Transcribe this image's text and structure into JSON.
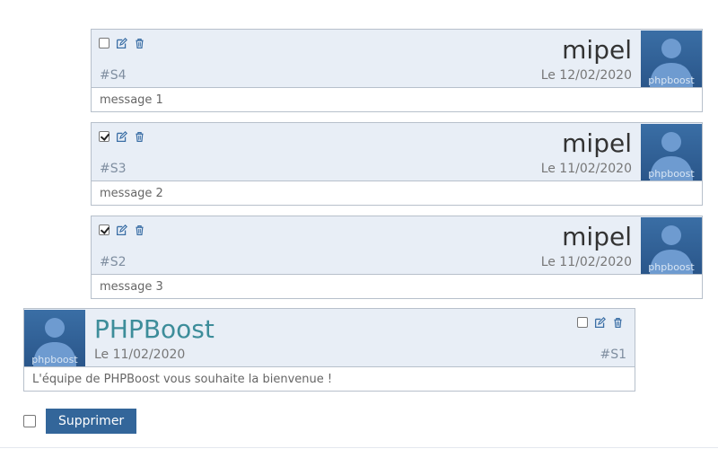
{
  "messages": [
    {
      "checked": false,
      "author": "mipel",
      "id": "#S4",
      "date": "Le 12/02/2020",
      "body": "message 1",
      "avatar_label": "phpboost"
    },
    {
      "checked": true,
      "author": "mipel",
      "id": "#S3",
      "date": "Le 11/02/2020",
      "body": "message 2",
      "avatar_label": "phpboost"
    },
    {
      "checked": true,
      "author": "mipel",
      "id": "#S2",
      "date": "Le 11/02/2020",
      "body": "message 3",
      "avatar_label": "phpboost"
    },
    {
      "checked": false,
      "author": "PHPBoost",
      "id": "#S1",
      "date": "Le 11/02/2020",
      "body": "L'équipe de PHPBoost vous souhaite la bienvenue !",
      "avatar_label": "phpboost"
    }
  ],
  "footer": {
    "delete_label": "Supprimer",
    "select_all_checked": false
  },
  "colors": {
    "header_bg": "#e8eef6",
    "accent": "#33669a",
    "admin_name": "#3d8d9a"
  },
  "icons": {
    "edit": "edit-icon",
    "delete": "trash-icon",
    "avatar": "default-avatar"
  }
}
